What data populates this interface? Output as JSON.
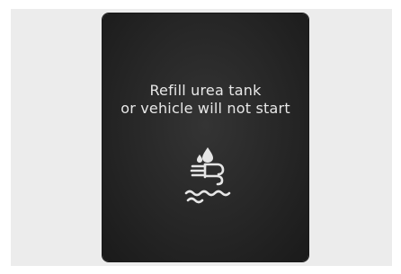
{
  "display": {
    "message_line_1": "Refill urea tank",
    "message_line_2": "or vehicle will not start",
    "icon": "urea-tank-warning-icon",
    "colors": {
      "screen_background": "#262626",
      "text": "#e8e8e8",
      "outer_frame": "#ececec"
    }
  }
}
